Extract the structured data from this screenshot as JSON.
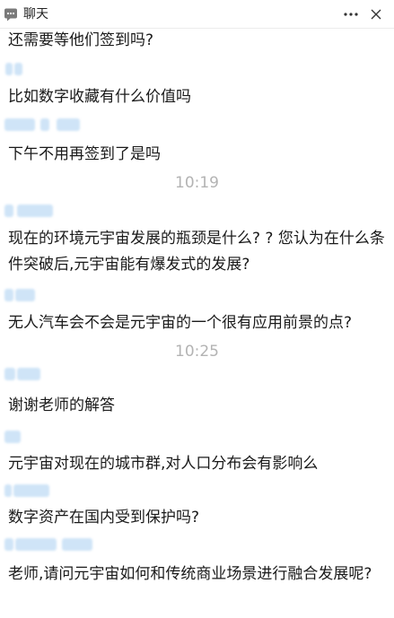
{
  "window": {
    "title": "聊天",
    "app_icon": "chat-bubble-icon",
    "more_icon": "more-horizontal-icon",
    "close_icon": "close-icon"
  },
  "colors": {
    "timestamp": "#b3b3b3",
    "redacted_name": "#cfe4f7"
  },
  "messages": [
    {
      "text": "还需要等他们签到吗?"
    },
    {
      "text": "比如数字收藏有什么价值吗"
    },
    {
      "text": "下午不用再签到了是吗"
    },
    {
      "time": "10:19"
    },
    {
      "text": "现在的环境元宇宙发展的瓶颈是什么? ? 您认为在什么条件突破后,元宇宙能有爆发式的发展?"
    },
    {
      "text": "无人汽车会不会是元宇宙的一个很有应用前景的点?"
    },
    {
      "time": "10:25"
    },
    {
      "text": "谢谢老师的解答"
    },
    {
      "text": "元宇宙对现在的城市群,对人口分布会有影响么"
    },
    {
      "text": "数字资产在国内受到保护吗?"
    },
    {
      "text": "老师,请问元宇宙如何和传统商业场景进行融合发展呢?"
    }
  ]
}
